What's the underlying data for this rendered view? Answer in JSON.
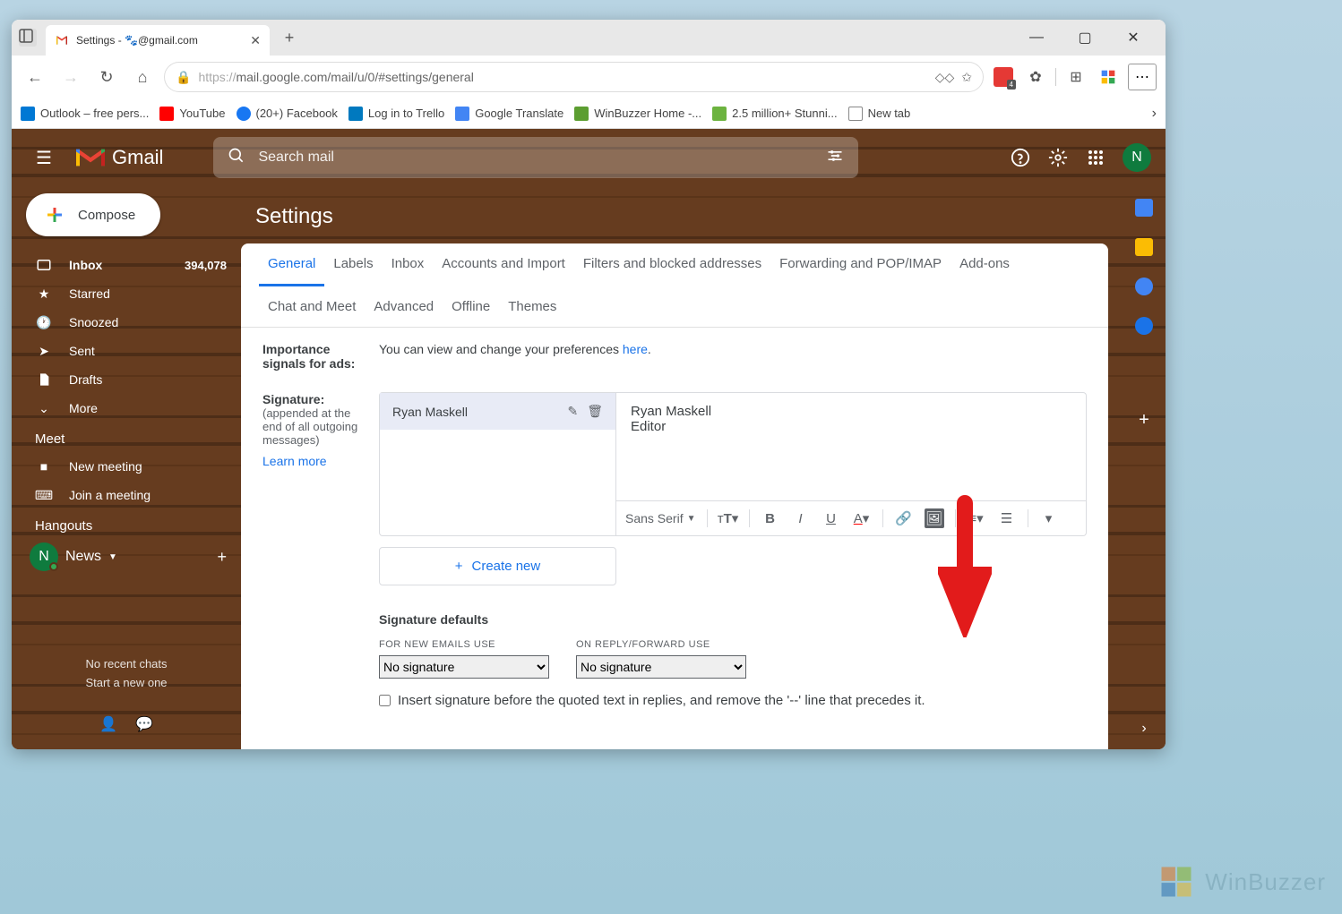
{
  "browser": {
    "tab_title": "Settings - 🐾@gmail.com",
    "url_prefix": "https://",
    "url_path": "mail.google.com/mail/u/0/#settings/general",
    "bookmarks": [
      {
        "label": "Outlook – free pers...",
        "color": "#0078d4"
      },
      {
        "label": "YouTube",
        "color": "#ff0000"
      },
      {
        "label": "(20+) Facebook",
        "color": "#1877f2"
      },
      {
        "label": "Log in to Trello",
        "color": "#0079bf"
      },
      {
        "label": "Google Translate",
        "color": "#4285f4"
      },
      {
        "label": "WinBuzzer Home -...",
        "color": "#5c9e31"
      },
      {
        "label": "2.5 million+ Stunni...",
        "color": "#6cb33f"
      },
      {
        "label": "New tab",
        "color": "#888888"
      }
    ],
    "ext_badge": "4"
  },
  "gmail": {
    "logo_text": "Gmail",
    "search_placeholder": "Search mail",
    "avatar_letter": "N",
    "compose_label": "Compose",
    "sidebar": {
      "items": [
        {
          "label": "Inbox",
          "count": "394,078"
        },
        {
          "label": "Starred"
        },
        {
          "label": "Snoozed"
        },
        {
          "label": "Sent"
        },
        {
          "label": "Drafts"
        },
        {
          "label": "More"
        }
      ],
      "meet_title": "Meet",
      "meet_items": [
        "New meeting",
        "Join a meeting"
      ],
      "hangouts_title": "Hangouts",
      "hangouts_user": "News",
      "no_chats_line1": "No recent chats",
      "no_chats_line2": "Start a new one"
    },
    "settings": {
      "title": "Settings",
      "tabs_row1": [
        "General",
        "Labels",
        "Inbox",
        "Accounts and Import",
        "Filters and blocked addresses",
        "Forwarding and POP/IMAP",
        "Add-ons"
      ],
      "tabs_row2": [
        "Chat and Meet",
        "Advanced",
        "Offline",
        "Themes"
      ],
      "importance_label": "Importance signals for ads:",
      "importance_text": "You can view and change your preferences ",
      "importance_link": "here",
      "signature_label": "Signature:",
      "signature_desc": "(appended at the end of all outgoing messages)",
      "learn_more": "Learn more",
      "sig_name": "Ryan Maskell",
      "sig_content_line1": "Ryan Maskell",
      "sig_content_line2": "Editor",
      "font_name": "Sans Serif",
      "create_new": "Create new",
      "defaults_title": "Signature defaults",
      "for_new_label": "FOR NEW EMAILS USE",
      "on_reply_label": "ON REPLY/FORWARD USE",
      "no_signature": "No signature",
      "insert_text": "Insert signature before the quoted text in replies, and remove the '--' line that precedes it."
    }
  },
  "watermark": "WinBuzzer"
}
